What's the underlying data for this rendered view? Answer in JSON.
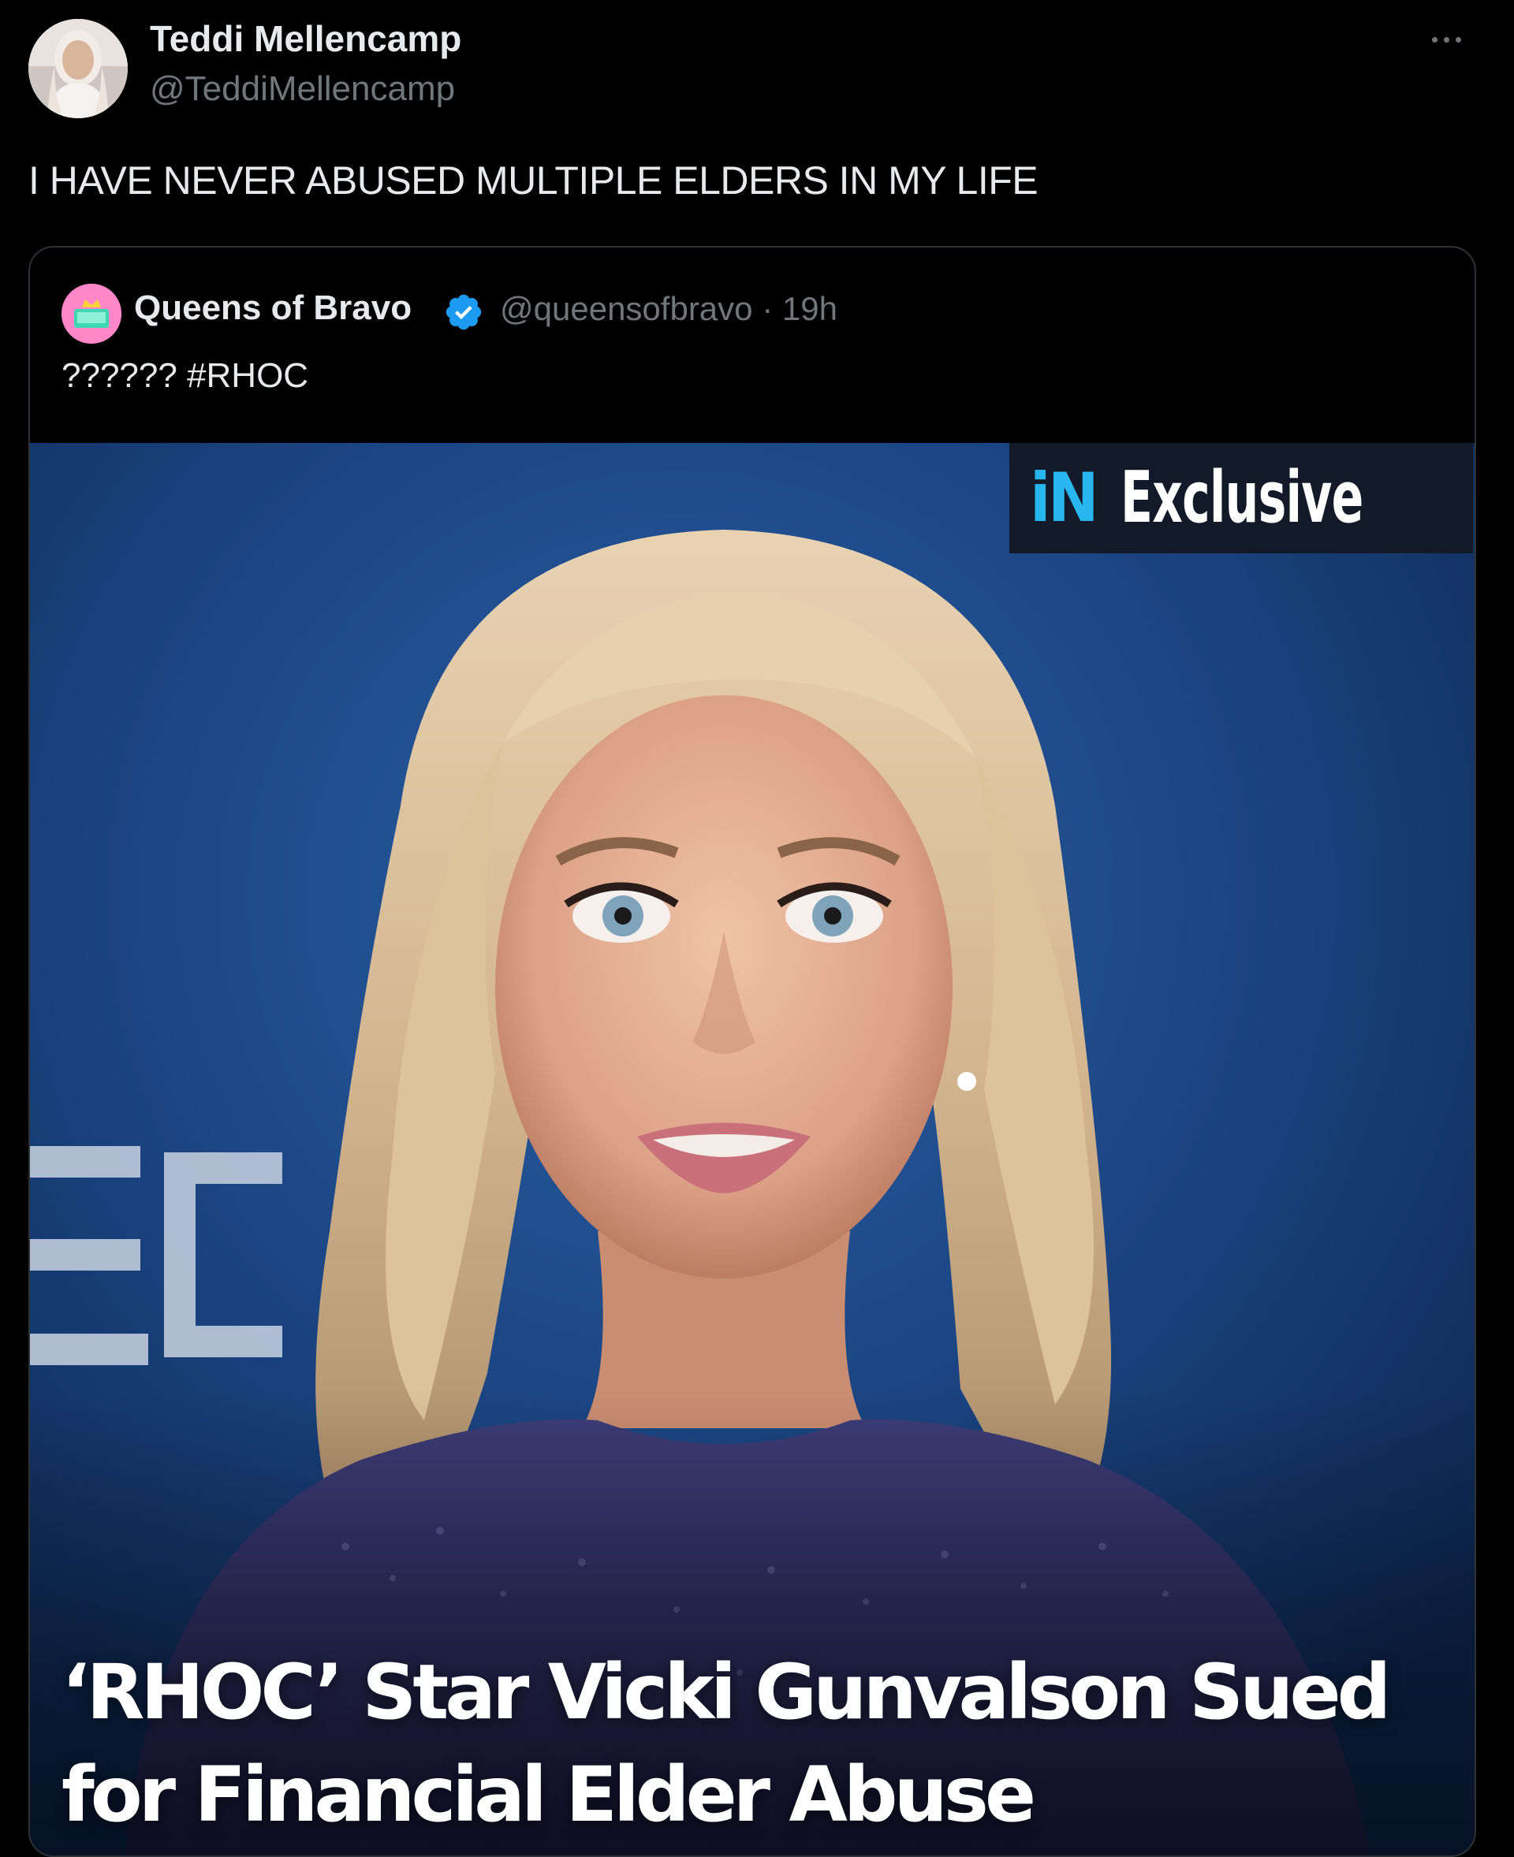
{
  "tweet": {
    "author": {
      "name": "Teddi Mellencamp",
      "handle": "@TeddiMellencamp"
    },
    "text": "I HAVE NEVER ABUSED MULTIPLE ELDERS IN MY LIFE",
    "more_icon": "more-horizontal-icon"
  },
  "quoted_tweet": {
    "author": {
      "name": "Queens of Bravo",
      "verified": true,
      "handle": "@queensofbravo",
      "separator": "·",
      "time": "19h"
    },
    "text": "?????? #RHOC",
    "media": {
      "badge": {
        "logo": "iN",
        "label": "Exclusive"
      },
      "headline_lines": [
        "‘RHOC’ Star Vicki Gunvalson Sued",
        "for Financial Elder Abuse"
      ]
    }
  },
  "colors": {
    "background": "#000000",
    "primary_text": "#e7e9ea",
    "secondary_text": "#71767b",
    "verified_blue": "#1d9bf0",
    "card_border": "#2f3336",
    "photo_backdrop": "#17396f",
    "badge_accent": "#27b6f0"
  }
}
